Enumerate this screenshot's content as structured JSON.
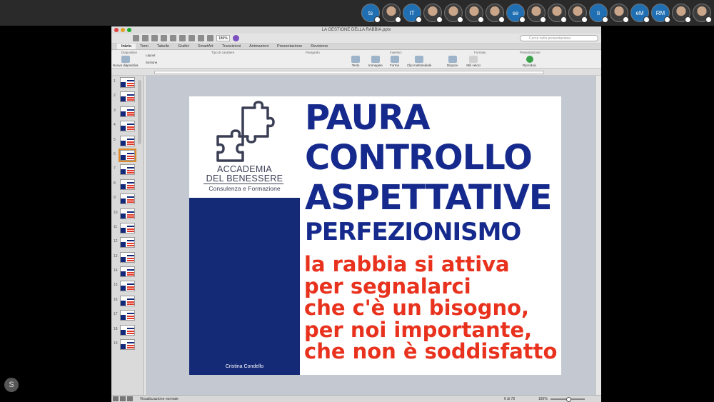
{
  "meeting": {
    "participants": [
      {
        "label": "ts",
        "kind": "letters"
      },
      {
        "label": "",
        "kind": "photo"
      },
      {
        "label": "IT",
        "kind": "letters"
      },
      {
        "label": "",
        "kind": "photo"
      },
      {
        "label": "",
        "kind": "photo"
      },
      {
        "label": "",
        "kind": "photo"
      },
      {
        "label": "",
        "kind": "photo"
      },
      {
        "label": "se",
        "kind": "letters"
      },
      {
        "label": "",
        "kind": "photo"
      },
      {
        "label": "",
        "kind": "photo"
      },
      {
        "label": "",
        "kind": "photo"
      },
      {
        "label": "ti",
        "kind": "letters"
      },
      {
        "label": "",
        "kind": "photo"
      },
      {
        "label": "eM",
        "kind": "letters"
      },
      {
        "label": "RM",
        "kind": "letters"
      },
      {
        "label": "",
        "kind": "photo"
      },
      {
        "label": "",
        "kind": "photo"
      }
    ],
    "side_button": "S"
  },
  "window": {
    "title": "LA GESTIONE DELLA RABBIA.pptx",
    "zoom": "186%",
    "search_placeholder": "Cerca nella presentazione"
  },
  "ribbon": {
    "tabs": [
      "Inizio",
      "Temi",
      "Tabelle",
      "Grafici",
      "SmartArt",
      "Transizioni",
      "Animazioni",
      "Presentazione",
      "Revisione"
    ],
    "active_tab": "Inizio",
    "groups": [
      "Diapositive",
      "Tipo di carattere",
      "Paragrafo",
      "Inserisci",
      "Formato",
      "Presentazione"
    ],
    "items": {
      "new_slide": "Nuova diapositiva",
      "layout": "Layout",
      "section": "Sezione",
      "text": "Testo",
      "image": "Immagine",
      "shape": "Forma",
      "media": "Clip multimediale",
      "arrange": "Disponi",
      "quick_styles": "Stili veloci",
      "play": "Riproduci"
    }
  },
  "thumbnails": {
    "count": 19,
    "selected": 6,
    "numbers": [
      "1",
      "2",
      "3",
      "4",
      "5",
      "6",
      "7",
      "8",
      "9",
      "10",
      "11",
      "12",
      "13",
      "14",
      "15",
      "16",
      "17",
      "18",
      "19"
    ]
  },
  "slide": {
    "logo_line1": "ACCADEMIA",
    "logo_line2": "DEL BENESSERE",
    "logo_sub": "Consulenza e Formazione",
    "author": "Cristina Condello",
    "headings": [
      "PAURA",
      "CONTROLLO",
      "ASPETTATIVE",
      "PERFEZIONISMO"
    ],
    "body_lines": [
      "la rabbia si attiva",
      "per segnalarci",
      "che c'è un bisogno,",
      "per noi importante,",
      "che non è soddisfatto"
    ],
    "colors": {
      "blue": "#152a8c",
      "red": "#e8321e",
      "panel": "#152a77"
    }
  },
  "status": {
    "view": "Visualizzazione normale",
    "page": "6 di 78",
    "zoom": "186%"
  }
}
